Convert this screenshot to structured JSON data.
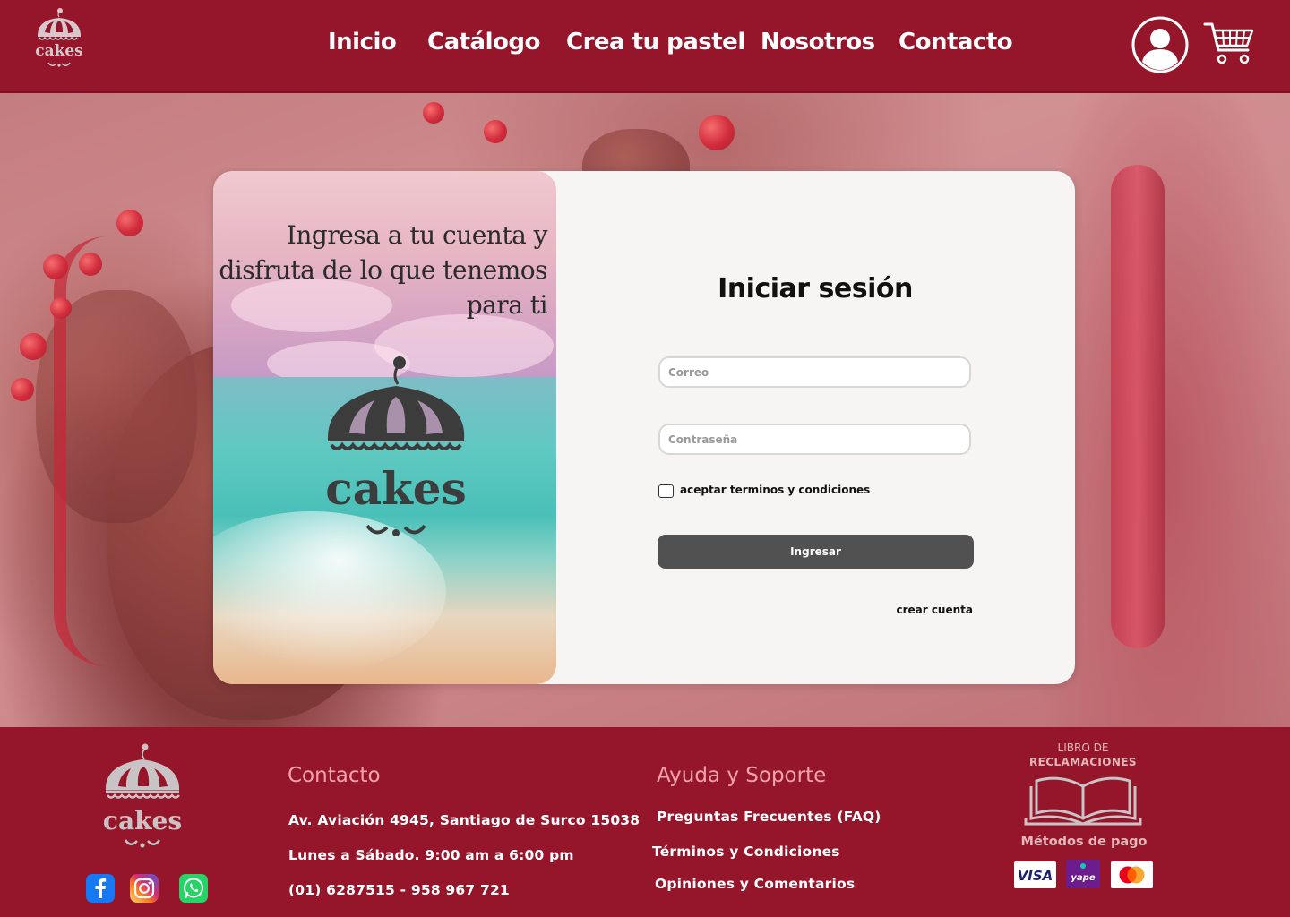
{
  "header": {
    "logo_text": "cakes",
    "nav": [
      "Inicio",
      "Catálogo",
      "Crea tu pastel",
      "Nosotros",
      "Contacto"
    ],
    "icons": [
      "user-icon",
      "cart-icon"
    ]
  },
  "login": {
    "tagline_line1": "Ingresa a tu cuenta y",
    "tagline_line2": "disfruta de lo que tenemos",
    "tagline_line3": "para ti",
    "logo_text": "cakes",
    "title": "Iniciar sesión",
    "email_placeholder": "Correo",
    "password_placeholder": "Contraseña",
    "terms_label": "aceptar terminos y condiciones",
    "terms_checked": false,
    "submit_label": "Ingresar",
    "create_account": "crear cuenta"
  },
  "footer": {
    "logo_text": "cakes",
    "social": [
      "facebook-icon",
      "instagram-icon",
      "whatsapp-icon"
    ],
    "contact": {
      "title": "Contacto",
      "address": "Av. Aviación 4945, Santiago de Surco 15038",
      "hours": "Lunes a Sábado. 9:00 am a 6:00 pm",
      "phones": "(01) 6287515 - 958 967 721"
    },
    "help": {
      "title": "Ayuda y Soporte",
      "faq": "Preguntas Frecuentes (FAQ)",
      "terms": "Términos y Condiciones",
      "reviews": "Opiniones y Comentarios"
    },
    "libro_top": "LIBRO DE",
    "libro_bottom": "RECLAMACIONES",
    "payment_title": "Métodos de pago",
    "payments": [
      "VISA",
      "yape",
      "mastercard"
    ]
  },
  "colors": {
    "brand": "#95162b",
    "footer_title": "#f5a3ab",
    "button": "#515151",
    "card": "#f7f4f4"
  }
}
